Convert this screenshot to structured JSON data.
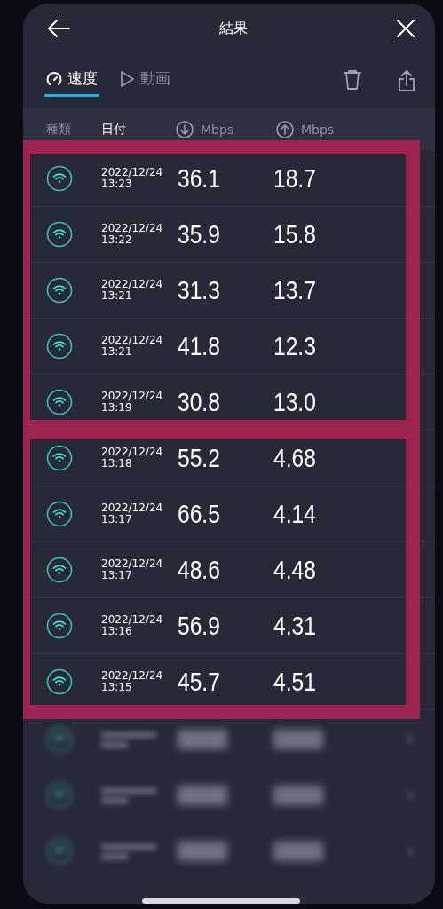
{
  "header": {
    "title": "結果"
  },
  "tabs": [
    {
      "label": "速度",
      "selected": true
    },
    {
      "label": "動画",
      "selected": false
    }
  ],
  "columns": [
    {
      "label": "種類",
      "active": false
    },
    {
      "label": "日付",
      "active": true
    },
    {
      "label": "Mbps"
    },
    {
      "label": "Mbps"
    }
  ],
  "row_groups": [
    {
      "highlighted": true,
      "rows": [
        {
          "kind": "result",
          "date": "2022/12/24",
          "time": "13:23",
          "download": "36.1",
          "upload": "18.7"
        },
        {
          "kind": "result",
          "date": "2022/12/24",
          "time": "13:22",
          "download": "35.9",
          "upload": "15.8"
        },
        {
          "kind": "result",
          "date": "2022/12/24",
          "time": "13:21",
          "download": "31.3",
          "upload": "13.7"
        },
        {
          "kind": "result",
          "date": "2022/12/24",
          "time": "13:21",
          "download": "41.8",
          "upload": "12.3"
        },
        {
          "kind": "result",
          "date": "2022/12/24",
          "time": "13:19",
          "download": "30.8",
          "upload": "13.0"
        }
      ]
    },
    {
      "highlighted": true,
      "rows": [
        {
          "kind": "result",
          "date": "2022/12/24",
          "time": "13:18",
          "download": "55.2",
          "upload": "4.68"
        },
        {
          "kind": "result",
          "date": "2022/12/24",
          "time": "13:17",
          "download": "66.5",
          "upload": "4.14"
        },
        {
          "kind": "result",
          "date": "2022/12/24",
          "time": "13:17",
          "download": "48.6",
          "upload": "4.48"
        },
        {
          "kind": "result",
          "date": "2022/12/24",
          "time": "13:16",
          "download": "56.9",
          "upload": "4.31"
        },
        {
          "kind": "result",
          "date": "2022/12/24",
          "time": "13:15",
          "download": "45.7",
          "upload": "4.51"
        }
      ]
    },
    {
      "highlighted": false,
      "rows": [
        {
          "kind": "blurred"
        },
        {
          "kind": "blurred"
        },
        {
          "kind": "blurred"
        }
      ]
    }
  ]
}
